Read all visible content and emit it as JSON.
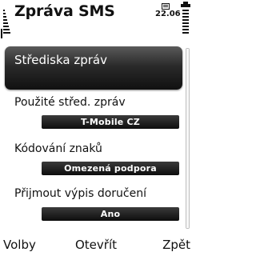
{
  "header": {
    "title": "Zpráva SMS",
    "clock": "22.06",
    "signal_icon": "signal-strength-icon",
    "battery_icon": "battery-level-icon",
    "message_icon": "message-indicator-icon"
  },
  "list": {
    "focused_item": "Střediska zpráv",
    "settings": [
      {
        "label": "Použité střed. zpráv",
        "value": "T-Mobile CZ"
      },
      {
        "label": "Kódování znaků",
        "value": "Omezená podpora"
      },
      {
        "label": "Přijmout výpis doručení",
        "value": "Ano"
      }
    ]
  },
  "softkeys": {
    "left": "Volby",
    "middle": "Otevřít",
    "right": "Zpět"
  },
  "colors": {
    "focus_background": "#1f1f1f",
    "value_background": "#1a1a1a",
    "text": "#111111"
  }
}
